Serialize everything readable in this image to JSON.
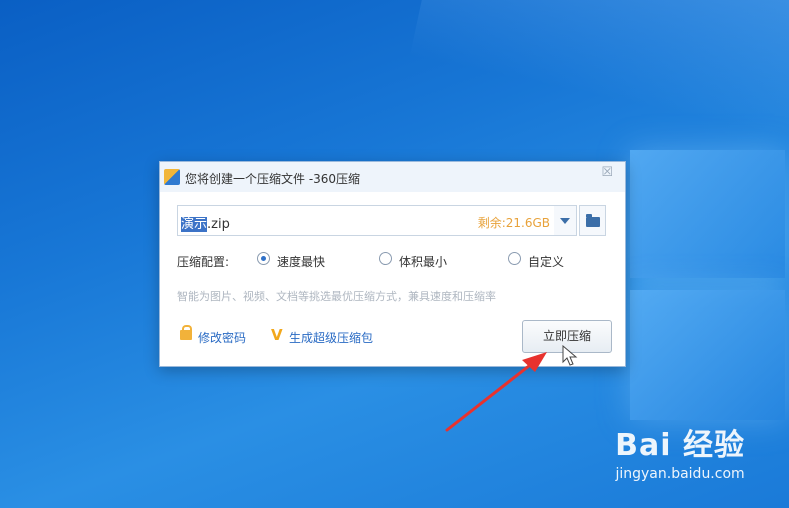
{
  "dialog": {
    "title": "您将创建一个压缩文件 -360压缩",
    "file_name_selected": "演示",
    "file_name_ext": ".zip",
    "free_space": "剩余:21.6GB",
    "config_label": "压缩配置:",
    "options": [
      {
        "label": "速度最快",
        "selected": true
      },
      {
        "label": "体积最小",
        "selected": false
      },
      {
        "label": "自定义",
        "selected": false
      }
    ],
    "description": "智能为图片、视频、文档等挑选最优压缩方式，兼具速度和压缩率",
    "links": {
      "change_password": "修改密码",
      "create_super": "生成超级压缩包"
    },
    "compress_button": "立即压缩"
  },
  "watermark": {
    "main": "Bai 经验",
    "sub": "jingyan.baidu.com"
  },
  "colors": {
    "accent": "#2a6bc4",
    "space_text": "#e8a23a",
    "annotation_arrow": "#e8322e"
  },
  "icons": {
    "app": "360zip-icon",
    "close": "close-icon",
    "dropdown": "chevron-down-icon",
    "folder": "folder-icon",
    "password": "lock-icon",
    "super": "v-badge-icon",
    "pointer": "mouse-cursor-icon"
  }
}
